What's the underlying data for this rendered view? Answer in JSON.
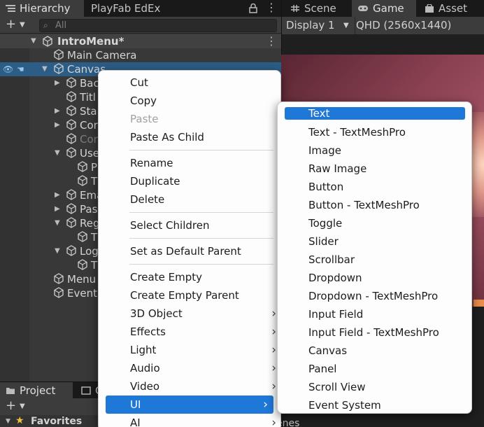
{
  "hierarchy": {
    "tabs": [
      {
        "label": "Hierarchy",
        "icon": "hierarchy-list-icon"
      },
      {
        "label": "PlayFab EdEx"
      }
    ],
    "search_placeholder": "All",
    "scene_name": "IntroMenu*",
    "rows": [
      {
        "label": "Main Camera",
        "indent": 1
      },
      {
        "label": "Canvas",
        "indent": 1
      },
      {
        "label": "Bac",
        "indent": 2
      },
      {
        "label": "Titl",
        "indent": 2
      },
      {
        "label": "Sta",
        "indent": 2
      },
      {
        "label": "Cor",
        "indent": 2
      },
      {
        "label": "Cor",
        "indent": 2
      },
      {
        "label": "Use",
        "indent": 2
      },
      {
        "label": "P",
        "indent": 3
      },
      {
        "label": "T",
        "indent": 3
      },
      {
        "label": "Ema",
        "indent": 2
      },
      {
        "label": "Pas",
        "indent": 2
      },
      {
        "label": "Reg",
        "indent": 2
      },
      {
        "label": "T",
        "indent": 3
      },
      {
        "label": "Log",
        "indent": 2
      },
      {
        "label": "T",
        "indent": 3
      },
      {
        "label": "Menu",
        "indent": 1
      },
      {
        "label": "Event",
        "indent": 1
      }
    ]
  },
  "game": {
    "tabs": [
      {
        "label": "Scene",
        "icon": "scene-grid-icon"
      },
      {
        "label": "Game",
        "icon": "gamepad-icon"
      },
      {
        "label": "Asset Sto",
        "icon": "asset-store-bag-icon"
      }
    ],
    "display": "Display 1",
    "resolution": "QHD (2560x1440)"
  },
  "project": {
    "tabs": [
      {
        "label": "Project",
        "icon": "folder-icon"
      },
      {
        "label": "C",
        "icon": "console-icon"
      }
    ],
    "favorites": "Favorites",
    "scenes": "enes"
  },
  "context_menu": {
    "items": [
      {
        "label": "Cut"
      },
      {
        "label": "Copy"
      },
      {
        "label": "Paste",
        "disabled": true
      },
      {
        "label": "Paste As Child"
      },
      {
        "label": "Rename"
      },
      {
        "label": "Duplicate"
      },
      {
        "label": "Delete"
      },
      {
        "label": "Select Children"
      },
      {
        "label": "Set as Default Parent"
      },
      {
        "label": "Create Empty"
      },
      {
        "label": "Create Empty Parent"
      },
      {
        "label": "3D Object",
        "submenu": true
      },
      {
        "label": "Effects",
        "submenu": true
      },
      {
        "label": "Light",
        "submenu": true
      },
      {
        "label": "Audio",
        "submenu": true
      },
      {
        "label": "Video",
        "submenu": true
      },
      {
        "label": "UI",
        "submenu": true,
        "highlighted": true
      },
      {
        "label": "AI",
        "submenu": true
      }
    ]
  },
  "ui_submenu": {
    "items": [
      {
        "label": "Text",
        "highlighted": true
      },
      {
        "label": "Text - TextMeshPro"
      },
      {
        "label": "Image"
      },
      {
        "label": "Raw Image"
      },
      {
        "label": "Button"
      },
      {
        "label": "Button - TextMeshPro"
      },
      {
        "label": "Toggle"
      },
      {
        "label": "Slider"
      },
      {
        "label": "Scrollbar"
      },
      {
        "label": "Dropdown"
      },
      {
        "label": "Dropdown - TextMeshPro"
      },
      {
        "label": "Input Field"
      },
      {
        "label": "Input Field - TextMeshPro"
      },
      {
        "label": "Canvas"
      },
      {
        "label": "Panel"
      },
      {
        "label": "Scroll View"
      },
      {
        "label": "Event System"
      }
    ]
  },
  "colors": {
    "selection": "#2c5d87",
    "menu_highlight": "#1e78d7"
  }
}
